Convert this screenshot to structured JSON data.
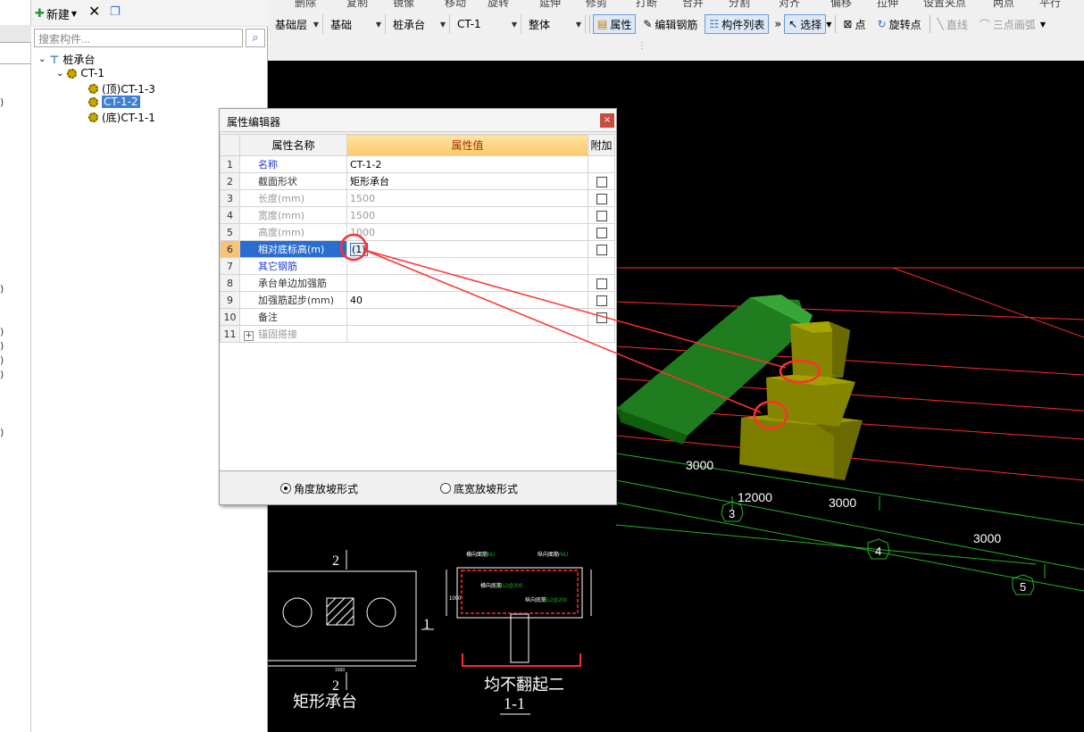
{
  "left_strip": {
    "marks": [
      ")",
      ")",
      ")",
      ")",
      ")",
      ")",
      ")"
    ]
  },
  "tree_panel": {
    "new_label": "新建",
    "search_placeholder": "搜索构件...",
    "root": "桩承台",
    "group": "CT-1",
    "items": [
      "(顶)CT-1-3",
      "CT-1-2",
      "(底)CT-1-1"
    ]
  },
  "toolbar": {
    "top_items": [
      "删除",
      "复制",
      "镜像",
      "移动",
      "旋转",
      "延伸",
      "修剪",
      "打断",
      "合并",
      "分割",
      "对齐",
      "偏移",
      "拉伸",
      "设置夹点",
      "两点",
      "平行"
    ],
    "combos": [
      "基础层",
      "基础",
      "桩承台",
      "CT-1",
      "整体"
    ],
    "property_btn": "属性",
    "edit_rebar_btn": "编辑钢筋",
    "component_list_btn": "构件列表",
    "more": "»",
    "select_btn": "选择",
    "point_btn": "点",
    "rotate_point_btn": "旋转点",
    "line_btn": "直线",
    "arc_btn": "三点画弧"
  },
  "viewport": {
    "dims": [
      "3000",
      "12000",
      "3000",
      "3000"
    ],
    "axis_labels": [
      "3",
      "4",
      "5"
    ],
    "section_title": "矩形承台",
    "section_dims": [
      "2",
      "2",
      "1",
      "1",
      "1500",
      "1500"
    ],
    "rebar_notes": [
      "横向面筋",
      "纵向面筋",
      "横向底筋",
      "纵向底筋",
      "1000"
    ],
    "rebar_spec": "C12@200",
    "rebar_code": "YMJ",
    "section2_title": "均不翻起二",
    "section2_label": "1-1"
  },
  "dialog": {
    "title": "属性编辑器",
    "close": "×",
    "col_name": "属性名称",
    "col_value": "属性值",
    "col_extra": "附加",
    "rows": [
      {
        "num": "1",
        "name": "名称",
        "value": "CT-1-2"
      },
      {
        "num": "2",
        "name": "截面形状",
        "value": "矩形承台"
      },
      {
        "num": "3",
        "name": "长度(mm)",
        "value": "1500"
      },
      {
        "num": "4",
        "name": "宽度(mm)",
        "value": "1500"
      },
      {
        "num": "5",
        "name": "高度(mm)",
        "value": "1000"
      },
      {
        "num": "6",
        "name": "相对底标高(m)",
        "value": "(1)"
      },
      {
        "num": "7",
        "name": "其它钢筋",
        "value": ""
      },
      {
        "num": "8",
        "name": "承台单边加强筋",
        "value": ""
      },
      {
        "num": "9",
        "name": "加强筋起步(mm)",
        "value": "40"
      },
      {
        "num": "10",
        "name": "备注",
        "value": ""
      },
      {
        "num": "11",
        "name": "锚固搭接",
        "value": ""
      }
    ],
    "expander": "+",
    "radio_angle": "角度放坡形式",
    "radio_width": "底宽放坡形式"
  }
}
